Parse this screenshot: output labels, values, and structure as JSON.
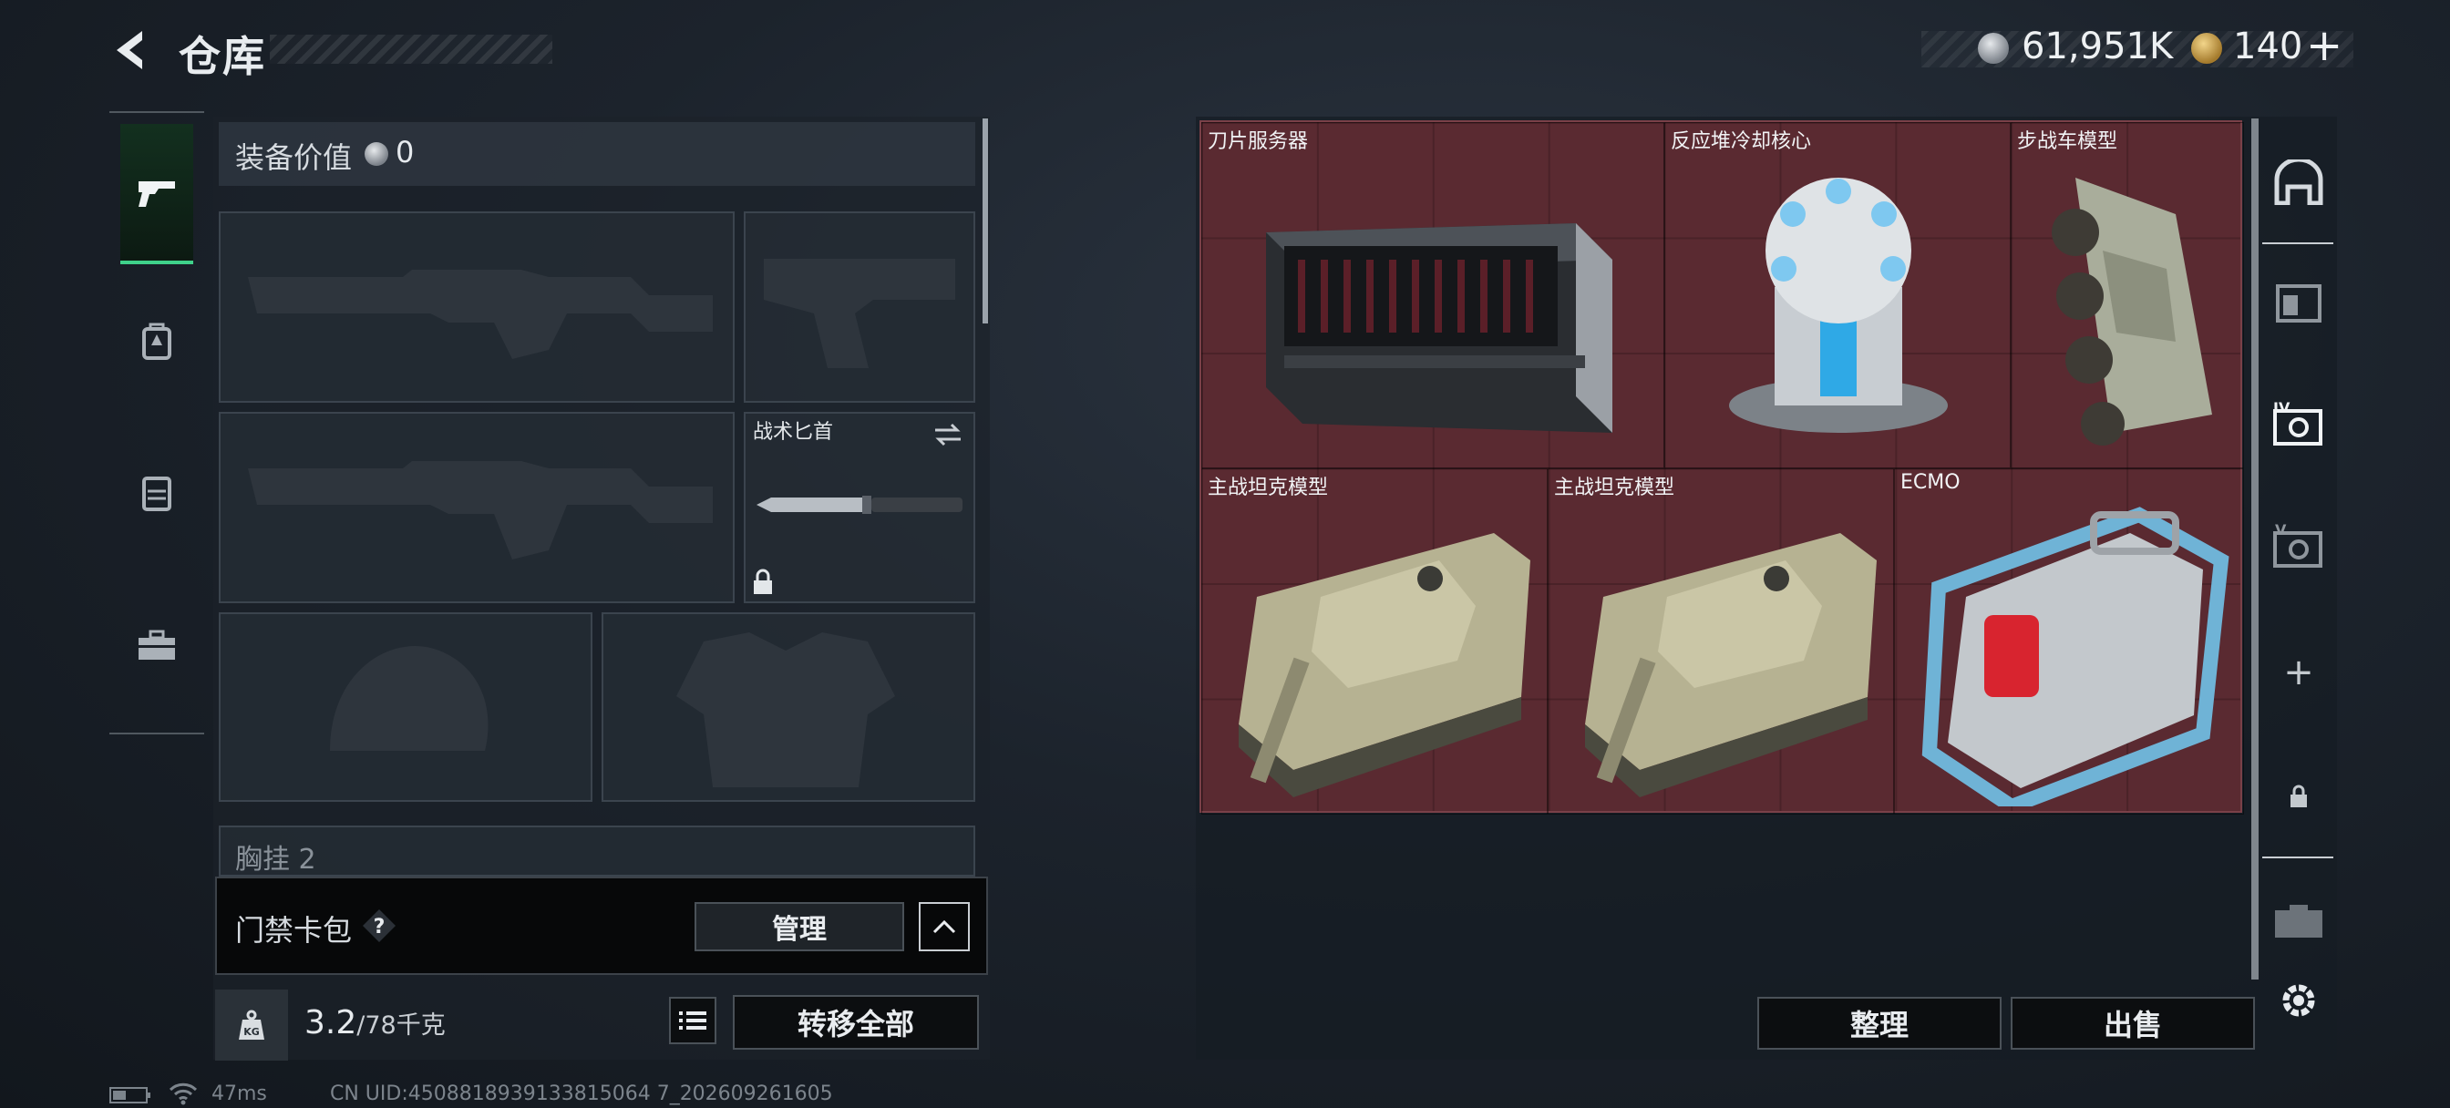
{
  "header": {
    "title": "仓库",
    "silver_amount": "61,951K",
    "gold_amount": "140",
    "plus_label": "+"
  },
  "equipment": {
    "value_label": "装备价值",
    "value": "0",
    "knife_slot_label": "战术匕首",
    "chest_slot_label": "胸挂",
    "chest_slot_count": "2"
  },
  "keycard": {
    "label": "门禁卡包",
    "help_label": "?",
    "manage_label": "管理"
  },
  "footer_left": {
    "weight_value": "3.2",
    "weight_capacity": "/78千克",
    "weight_icon_text": "KG",
    "transfer_all_label": "转移全部"
  },
  "storage": {
    "items": [
      {
        "name": "刀片服务器"
      },
      {
        "name": "反应堆冷却核心"
      },
      {
        "name": "步战车模型"
      },
      {
        "name": "主战坦克模型"
      },
      {
        "name": "主战坦克模型"
      },
      {
        "name": "ECMO"
      }
    ],
    "sort_label": "整理",
    "sell_label": "出售",
    "tab_iv": "IV",
    "tab_v": "V"
  },
  "status_bar": {
    "ping": "47ms",
    "uid": "CN UID:4508818939133815064 7_202609261605"
  },
  "colors": {
    "accent_green": "#3fd18a",
    "item_grid_bg": "#5a2a31"
  }
}
